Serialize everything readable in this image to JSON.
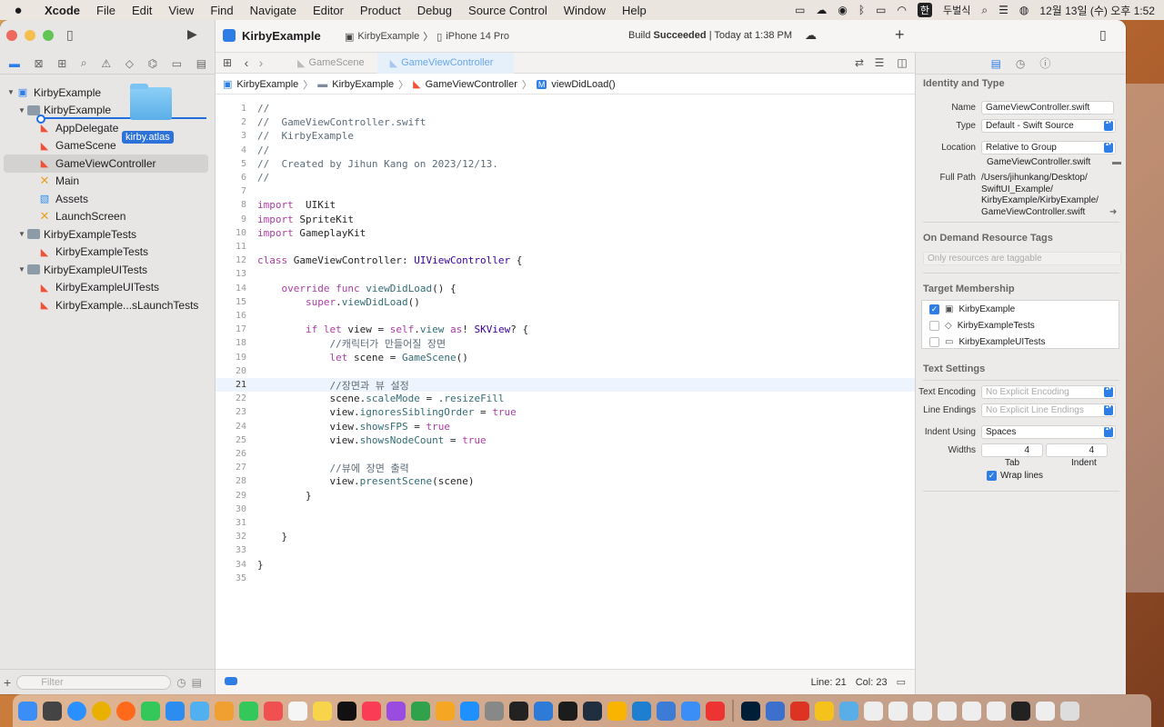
{
  "menubar": {
    "app": "Xcode",
    "items": [
      "File",
      "Edit",
      "View",
      "Find",
      "Navigate",
      "Editor",
      "Product",
      "Debug",
      "Source Control",
      "Window",
      "Help"
    ],
    "input_method": "한",
    "input_name": "두벌식",
    "datetime": "12월 13일 (수) 오후 1:52"
  },
  "titlebar": {
    "project": "KirbyExample",
    "scheme": "KirbyExample",
    "device": "iPhone 14 Pro",
    "build_status_prefix": "Build",
    "build_status": "Succeeded",
    "build_time": "Today at 1:38 PM"
  },
  "navigator": {
    "items": [
      {
        "label": "KirbyExample",
        "kind": "project",
        "disclosure": "▼"
      },
      {
        "label": "KirbyExample",
        "kind": "folder",
        "disclosure": "▼"
      },
      {
        "label": "AppDelegate",
        "kind": "swift"
      },
      {
        "label": "GameScene",
        "kind": "swift"
      },
      {
        "label": "GameViewController",
        "kind": "swift",
        "selected": true
      },
      {
        "label": "Main",
        "kind": "xib"
      },
      {
        "label": "Assets",
        "kind": "asset"
      },
      {
        "label": "LaunchScreen",
        "kind": "xib"
      },
      {
        "label": "KirbyExampleTests",
        "kind": "folder",
        "disclosure": "▼"
      },
      {
        "label": "KirbyExampleTests",
        "kind": "swift"
      },
      {
        "label": "KirbyExampleUITests",
        "kind": "folder",
        "disclosure": "▼"
      },
      {
        "label": "KirbyExampleUITests",
        "kind": "swift"
      },
      {
        "label": "KirbyExample...sLaunchTests",
        "kind": "swift"
      }
    ],
    "drag_label": "kirby.atlas",
    "filter_placeholder": "Filter"
  },
  "tabs": [
    "GameScene",
    "GameViewController"
  ],
  "breadcrumb": [
    "KirbyExample",
    "KirbyExample",
    "GameViewController",
    "viewDidLoad()"
  ],
  "code": [
    [
      [
        "c-com",
        "//"
      ]
    ],
    [
      [
        "c-com",
        "//  GameViewController.swift"
      ]
    ],
    [
      [
        "c-com",
        "//  KirbyExample"
      ]
    ],
    [
      [
        "c-com",
        "//"
      ]
    ],
    [
      [
        "c-com",
        "//  Created by Jihun Kang on 2023/12/13."
      ]
    ],
    [
      [
        "c-com",
        "//"
      ]
    ],
    [],
    [
      [
        "c-kw",
        "import"
      ],
      [
        "",
        "  UIKit"
      ]
    ],
    [
      [
        "c-kw",
        "import"
      ],
      [
        "",
        " SpriteKit"
      ]
    ],
    [
      [
        "c-kw",
        "import"
      ],
      [
        "",
        " GameplayKit"
      ]
    ],
    [],
    [
      [
        "c-kw",
        "class"
      ],
      [
        "",
        " GameViewController: "
      ],
      [
        "c-type",
        "UIViewController"
      ],
      [
        "",
        " {"
      ]
    ],
    [],
    [
      [
        "",
        "    "
      ],
      [
        "c-kw",
        "override func"
      ],
      [
        "",
        " "
      ],
      [
        "c-fn",
        "viewDidLoad"
      ],
      [
        "",
        "() {"
      ]
    ],
    [
      [
        "",
        "        "
      ],
      [
        "c-kw",
        "super"
      ],
      [
        "",
        "."
      ],
      [
        "c-fn",
        "viewDidLoad"
      ],
      [
        "",
        "()"
      ]
    ],
    [],
    [
      [
        "",
        "        "
      ],
      [
        "c-kw",
        "if let"
      ],
      [
        "",
        " view = "
      ],
      [
        "c-kw",
        "self"
      ],
      [
        "",
        "."
      ],
      [
        "c-prop",
        "view"
      ],
      [
        "",
        " "
      ],
      [
        "c-kw",
        "as"
      ],
      [
        "",
        "! "
      ],
      [
        "c-type",
        "SKView"
      ],
      [
        "",
        "? {"
      ]
    ],
    [
      [
        "",
        "            "
      ],
      [
        "c-com",
        "//캐릭터가 만들어질 장면"
      ]
    ],
    [
      [
        "",
        "            "
      ],
      [
        "c-kw",
        "let"
      ],
      [
        "",
        " scene = "
      ],
      [
        "c-fn",
        "GameScene"
      ],
      [
        "",
        "()"
      ]
    ],
    [],
    [
      [
        "",
        "            "
      ],
      [
        "c-com",
        "//장면과 뷰 설정"
      ]
    ],
    [
      [
        "",
        "            scene."
      ],
      [
        "c-prop",
        "scaleMode"
      ],
      [
        "",
        " = ."
      ],
      [
        "c-prop",
        "resizeFill"
      ]
    ],
    [
      [
        "",
        "            view."
      ],
      [
        "c-prop",
        "ignoresSiblingOrder"
      ],
      [
        "",
        " = "
      ],
      [
        "c-kw",
        "true"
      ]
    ],
    [
      [
        "",
        "            view."
      ],
      [
        "c-prop",
        "showsFPS"
      ],
      [
        "",
        " = "
      ],
      [
        "c-kw",
        "true"
      ]
    ],
    [
      [
        "",
        "            view."
      ],
      [
        "c-prop",
        "showsNodeCount"
      ],
      [
        "",
        " = "
      ],
      [
        "c-kw",
        "true"
      ]
    ],
    [],
    [
      [
        "",
        "            "
      ],
      [
        "c-com",
        "//뷰에 장면 출력"
      ]
    ],
    [
      [
        "",
        "            view."
      ],
      [
        "c-fn",
        "presentScene"
      ],
      [
        "",
        "(scene)"
      ]
    ],
    [
      [
        "",
        "        }"
      ]
    ],
    [],
    [],
    [
      [
        "",
        "    }"
      ]
    ],
    [],
    [
      [
        "",
        "}"
      ]
    ],
    []
  ],
  "current_line": 21,
  "status": {
    "line": "Line: 21",
    "col": "Col: 23"
  },
  "inspector": {
    "identity_title": "Identity and Type",
    "name_label": "Name",
    "name_value": "GameViewController.swift",
    "type_label": "Type",
    "type_value": "Default - Swift Source",
    "location_label": "Location",
    "location_value": "Relative to Group",
    "location_file": "GameViewController.swift",
    "fullpath_label": "Full Path",
    "fullpath_lines": [
      "/Users/jihunkang/Desktop/",
      "SwiftUI_Example/",
      "KirbyExample/KirbyExample/",
      "GameViewController.swift"
    ],
    "odr_title": "On Demand Resource Tags",
    "odr_placeholder": "Only resources are taggable",
    "target_title": "Target Membership",
    "targets": [
      {
        "label": "KirbyExample",
        "checked": true
      },
      {
        "label": "KirbyExampleTests",
        "checked": false
      },
      {
        "label": "KirbyExampleUITests",
        "checked": false
      }
    ],
    "text_title": "Text Settings",
    "encoding_label": "Text Encoding",
    "encoding_value": "No Explicit Encoding",
    "endings_label": "Line Endings",
    "endings_value": "No Explicit Line Endings",
    "indent_label": "Indent Using",
    "indent_value": "Spaces",
    "widths_label": "Widths",
    "tab_value": "4",
    "indent_value_num": "4",
    "tab_caption": "Tab",
    "indent_caption": "Indent",
    "wrap_label": "Wrap lines"
  }
}
